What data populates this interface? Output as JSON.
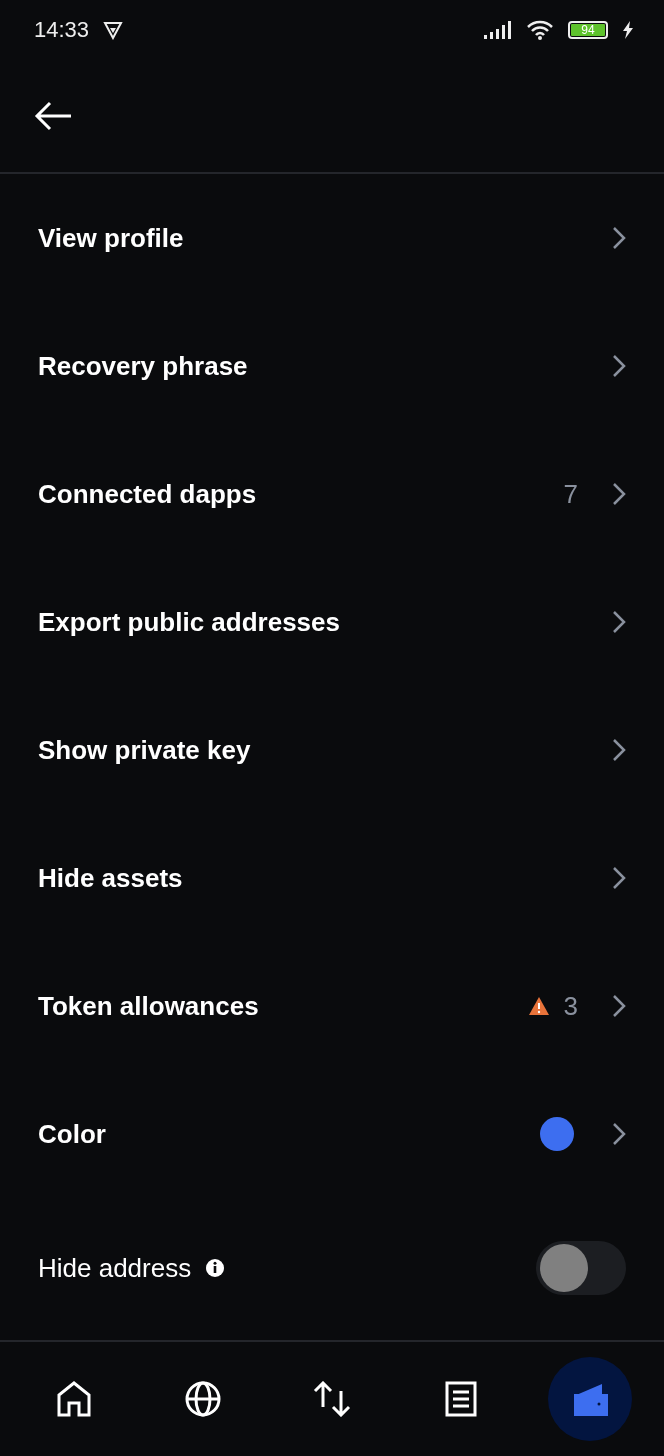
{
  "status_bar": {
    "time": "14:33",
    "battery": "94"
  },
  "items": [
    {
      "kind": "link",
      "label": "View profile"
    },
    {
      "kind": "link",
      "label": "Recovery phrase"
    },
    {
      "kind": "link",
      "label": "Connected dapps",
      "count": "7"
    },
    {
      "kind": "link",
      "label": "Export public addresses"
    },
    {
      "kind": "link",
      "label": "Show private key"
    },
    {
      "kind": "link",
      "label": "Hide assets"
    },
    {
      "kind": "link",
      "label": "Token allowances",
      "warning": true,
      "count": "3"
    },
    {
      "kind": "link",
      "label": "Color",
      "color": "#3d6ef0"
    },
    {
      "kind": "toggle",
      "label": "Hide address",
      "on": false
    }
  ],
  "nav": [
    {
      "kind": "home",
      "selected": false
    },
    {
      "kind": "globe",
      "selected": false
    },
    {
      "kind": "transfer",
      "selected": false
    },
    {
      "kind": "list",
      "selected": false
    },
    {
      "kind": "wallet",
      "selected": true
    }
  ]
}
